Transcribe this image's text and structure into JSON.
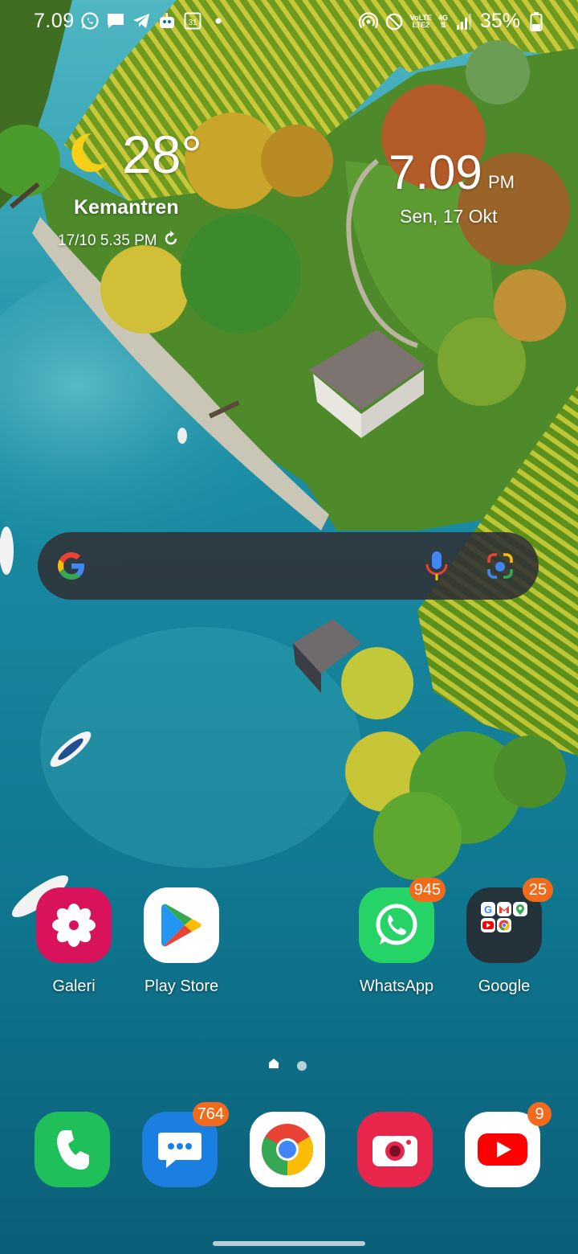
{
  "status_bar": {
    "time": "7.09",
    "network_top": "VoLTE",
    "network_bottom": "LTE2",
    "network_type": "4G",
    "battery": "35%",
    "left_icons": [
      "whatsapp-icon",
      "message-icon",
      "telegram-icon",
      "robot-icon",
      "calendar-icon",
      "dot-icon"
    ],
    "right_icons": [
      "hotspot-icon",
      "do-not-disturb-icon",
      "signal-icon",
      "battery-icon"
    ]
  },
  "weather": {
    "temperature": "28°",
    "location": "Kemantren",
    "updated": "17/10 5.35 PM",
    "condition_icon": "moon-icon"
  },
  "clock": {
    "time": "7.09",
    "ampm": "PM",
    "date": "Sen, 17 Okt"
  },
  "search": {
    "icons": [
      "google-logo-icon",
      "microphone-icon",
      "google-lens-icon"
    ]
  },
  "apps": [
    {
      "label": "Galeri",
      "badge": ""
    },
    {
      "label": "Play Store",
      "badge": ""
    },
    {
      "label": "WhatsApp",
      "badge": "945"
    },
    {
      "label": "Google",
      "badge": "25"
    }
  ],
  "dock": [
    {
      "name": "phone",
      "badge": ""
    },
    {
      "name": "messages",
      "badge": "764"
    },
    {
      "name": "chrome",
      "badge": ""
    },
    {
      "name": "camera",
      "badge": ""
    },
    {
      "name": "youtube",
      "badge": "9"
    }
  ],
  "pager": {
    "pages": 2,
    "current": 1
  },
  "colors": {
    "badge": "#f26a1b",
    "search_bg": "#303034",
    "galeri": "#d8125b",
    "whatsapp": "#25d366",
    "phone": "#1fbf5a",
    "messages": "#1a7fe0",
    "camera": "#e8254a",
    "youtube": "#ff0000"
  }
}
